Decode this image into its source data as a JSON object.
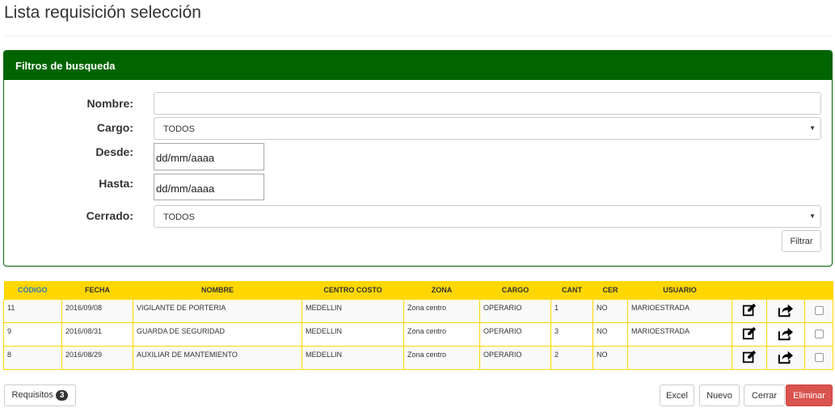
{
  "page": {
    "title": "Lista requisición selección"
  },
  "filters": {
    "heading": "Filtros de busqueda",
    "nombre": {
      "label": "Nombre:",
      "value": ""
    },
    "cargo": {
      "label": "Cargo:",
      "selected": "TODOS"
    },
    "desde": {
      "label": "Desde:",
      "value": "dd/mm/aaaa"
    },
    "hasta": {
      "label": "Hasta:",
      "value": "dd/mm/aaaa"
    },
    "cerrado": {
      "label": "Cerrado:",
      "selected": "TODOS"
    },
    "filter_button": "Filtrar"
  },
  "table": {
    "columns": [
      "CÓDIGO",
      "FECHA",
      "NOMBRE",
      "CENTRO COSTO",
      "ZONA",
      "CARGO",
      "CANT",
      "CER",
      "USUARIO"
    ],
    "rows": [
      {
        "codigo": "11",
        "fecha": "2016/09/08",
        "nombre": "VIGILANTE DE PORTERIA",
        "centro_costo": "MEDELLIN",
        "zona": "Zona centro",
        "cargo": "OPERARIO",
        "cant": "1",
        "cer": "NO",
        "usuario": "MARIOESTRADA"
      },
      {
        "codigo": "9",
        "fecha": "2016/08/31",
        "nombre": "GUARDA DE SEGURIDAD",
        "centro_costo": "MEDELLIN",
        "zona": "Zona centro",
        "cargo": "OPERARIO",
        "cant": "3",
        "cer": "NO",
        "usuario": "MARIOESTRADA"
      },
      {
        "codigo": "8",
        "fecha": "2016/08/29",
        "nombre": "AUXILIAR DE MANTEMIENTO",
        "centro_costo": "MEDELLIN",
        "zona": "Zona centro",
        "cargo": "OPERARIO",
        "cant": "2",
        "cer": "NO",
        "usuario": ""
      }
    ]
  },
  "footer": {
    "requisitos_label": "Requisitos",
    "requisitos_count": "3",
    "excel_label": "Excel",
    "nuevo_label": "Nuevo",
    "cerrar_label": "Cerrar",
    "eliminar_label": "Eliminar"
  },
  "icons": {
    "edit": "edit-icon",
    "share": "share-icon",
    "dropdown": "chevron-down-icon"
  },
  "colors": {
    "panel_green": "#006400",
    "table_header": "#ffd700",
    "danger": "#d9534f",
    "code_header": "#337ab7"
  }
}
